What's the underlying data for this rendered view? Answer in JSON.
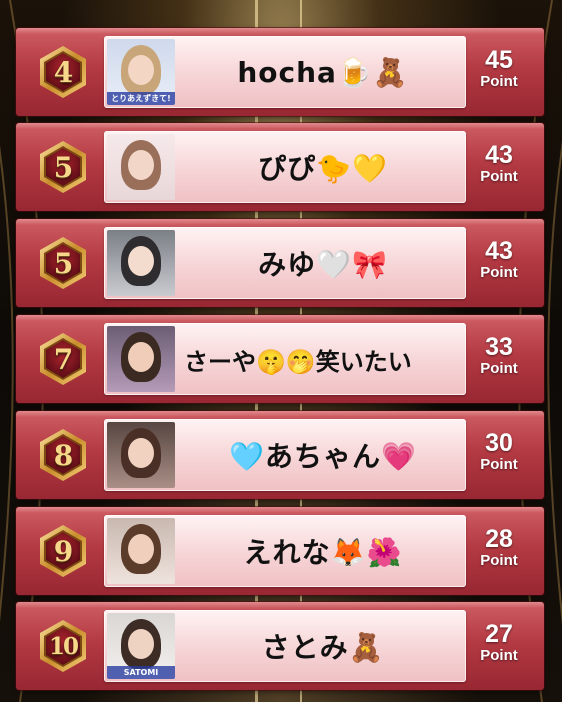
{
  "ranking": [
    {
      "rank": "4",
      "name": "hocha🍺🧸",
      "points": "45",
      "point_label": "Point",
      "photo_caption": "とりあえずきて!"
    },
    {
      "rank": "5",
      "name": "ぴぴ🐤💛",
      "points": "43",
      "point_label": "Point",
      "photo_caption": ""
    },
    {
      "rank": "5",
      "name": "みゆ🤍🎀",
      "points": "43",
      "point_label": "Point",
      "photo_caption": ""
    },
    {
      "rank": "7",
      "name": "さーや🤫🤭笑いたい",
      "points": "33",
      "point_label": "Point",
      "photo_caption": ""
    },
    {
      "rank": "8",
      "name": "🩵あちゃん💗",
      "points": "30",
      "point_label": "Point",
      "photo_caption": ""
    },
    {
      "rank": "9",
      "name": "えれな🦊🌺",
      "points": "28",
      "point_label": "Point",
      "photo_caption": ""
    },
    {
      "rank": "10",
      "name": "さとみ🧸",
      "points": "27",
      "point_label": "Point",
      "photo_caption": "SATOMI"
    }
  ],
  "colors": {
    "row_red": "#b43a43",
    "card_pink": "#f6d4d6",
    "badge_gold": "#d9a441",
    "badge_dark_red": "#7a1420"
  },
  "icons": {
    "rank_badge": "gold-hexagon-rank-icon"
  }
}
